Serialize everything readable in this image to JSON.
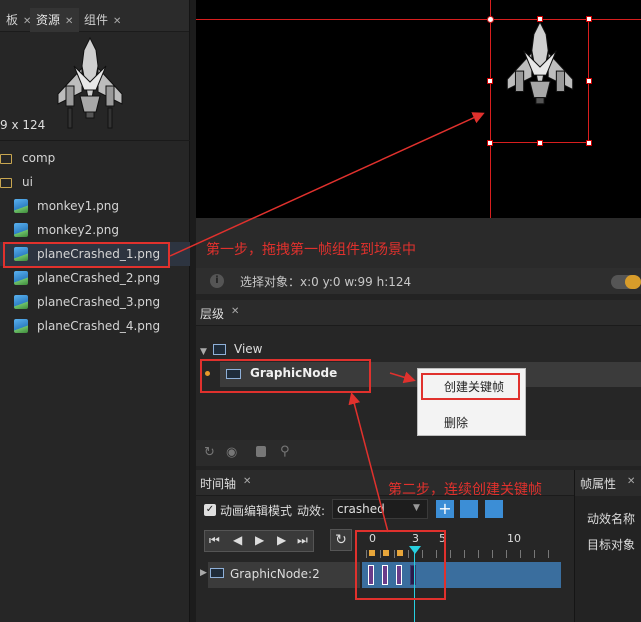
{
  "left_panel": {
    "tabs": [
      {
        "label": "板"
      },
      {
        "label": "资源"
      },
      {
        "label": "组件"
      }
    ],
    "preview_size": "9 x 124",
    "assets": [
      {
        "label": "comp",
        "type": "folder"
      },
      {
        "label": "ui",
        "type": "folder"
      },
      {
        "label": "monkey1.png",
        "type": "image"
      },
      {
        "label": "monkey2.png",
        "type": "image"
      },
      {
        "label": "planeCrashed_1.png",
        "type": "image",
        "selected": true
      },
      {
        "label": "planeCrashed_2.png",
        "type": "image"
      },
      {
        "label": "planeCrashed_3.png",
        "type": "image"
      },
      {
        "label": "planeCrashed_4.png",
        "type": "image"
      }
    ]
  },
  "info_bar": {
    "text": "选择对象：x:0 y:0  w:99 h:124"
  },
  "hierarchy": {
    "tab": "层级",
    "root": "View",
    "node": "GraphicNode"
  },
  "context_menu": {
    "items": [
      {
        "label": "创建关键帧"
      },
      {
        "label": "删除"
      }
    ]
  },
  "timeline": {
    "tab": "时间轴",
    "mode_label": "动画编辑模式",
    "effect_label": "动效:",
    "effect_value": "crashed",
    "ruler": [
      "0",
      "3",
      "5",
      "10"
    ],
    "track": "GraphicNode:2",
    "playhead_frame": 3
  },
  "frame_props": {
    "tab": "帧属性",
    "fields": [
      {
        "label": "动效名称"
      },
      {
        "label": "目标对象"
      }
    ]
  },
  "annotations": {
    "step1": "第一步，拖拽第一帧组件到场景中",
    "step2": "第二步，连续创建关键帧"
  },
  "colors": {
    "annotation": "#e0312d",
    "accent": "#3c8ed6",
    "track": "#3a6e9e",
    "playhead": "#27d0e0"
  }
}
